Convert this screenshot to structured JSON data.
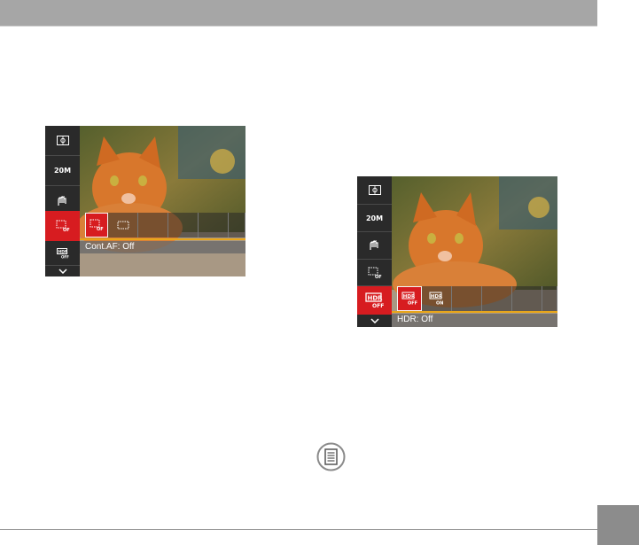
{
  "screen_left": {
    "menu_items": [
      "focus-area-icon",
      "20M",
      "stabilizer-off-icon",
      "continuous-af-off-icon",
      "hdr-off-icon",
      "chevron-down-icon"
    ],
    "size_label": "20M",
    "active_item": "continuous-af-off-icon",
    "options": [
      "continuous-af-off-icon",
      "continuous-af-on-icon"
    ],
    "caption": "Cont.AF: Off"
  },
  "screen_right": {
    "menu_items": [
      "focus-area-icon",
      "20M",
      "stabilizer-off-icon",
      "continuous-af-off-icon",
      "hdr-off-icon",
      "chevron-down-icon"
    ],
    "size_label": "20M",
    "active_item": "hdr-off-icon",
    "options": [
      "hdr-off-icon",
      "hdr-on-icon"
    ],
    "caption": "HDR: Off"
  },
  "colors": {
    "accent_red": "#d71c20",
    "accent_orange": "#e8a61a",
    "header_gray": "#a6a6a6"
  },
  "note_icon": "note-icon"
}
